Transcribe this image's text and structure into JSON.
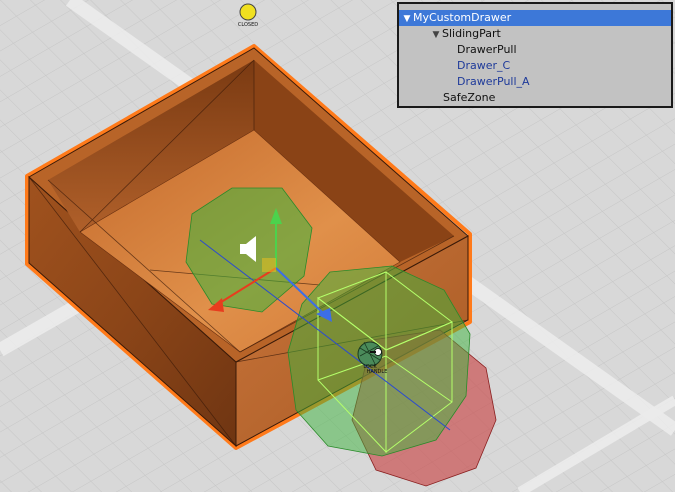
{
  "scene": {
    "state_gizmo_label": "CLOSED",
    "handle_gizmo_label_line1": "LOCK",
    "handle_gizmo_label_line2": "HANDLE",
    "colors": {
      "selection_outline": "#ff7a1a",
      "zone_green": "#3cb43c",
      "zone_red": "#c83c3c",
      "axis_y": "#4cd24c",
      "axis_x": "#e83c1e",
      "axis_z": "#3c6ee6",
      "state_indicator": "#f0e020"
    }
  },
  "hierarchy": {
    "items": [
      {
        "label": "MyCustomDrawer",
        "expanded": true,
        "selected": true,
        "prefab": false
      },
      {
        "label": "SlidingPart",
        "expanded": true,
        "selected": false,
        "prefab": false
      },
      {
        "label": "DrawerPull",
        "selected": false,
        "prefab": false
      },
      {
        "label": "Drawer_C",
        "selected": false,
        "prefab": true
      },
      {
        "label": "DrawerPull_A",
        "selected": false,
        "prefab": true
      },
      {
        "label": "SafeZone",
        "selected": false,
        "prefab": false
      }
    ]
  }
}
